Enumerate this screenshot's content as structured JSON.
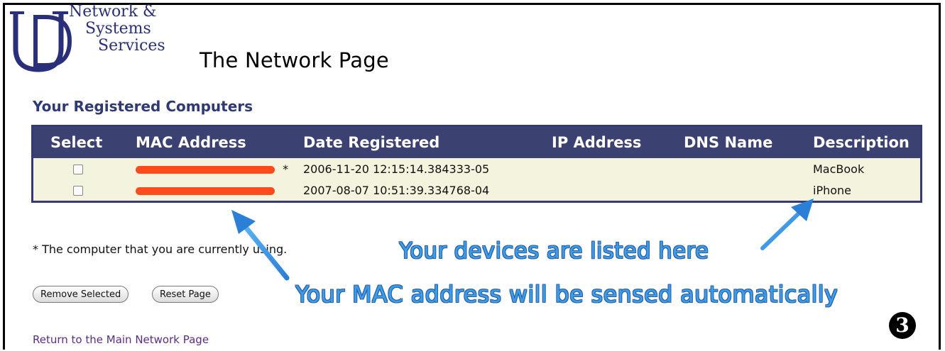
{
  "logo": {
    "line1": "Network &",
    "line2": "Systems",
    "line3": "Services",
    "color": "#2a2f7a"
  },
  "page_title": "The Network Page",
  "section_title": "Your Registered Computers",
  "table": {
    "headers": [
      "Select",
      "MAC Address",
      "Date Registered",
      "IP Address",
      "DNS Name",
      "Description"
    ],
    "rows": [
      {
        "mac_suffix": "*",
        "date": "2006-11-20 12:15:14.384333-05",
        "ip": "",
        "dns": "",
        "description": "MacBook"
      },
      {
        "mac_suffix": "",
        "date": "2007-08-07 10:51:39.334768-04",
        "ip": "",
        "dns": "",
        "description": "iPhone"
      }
    ],
    "header_color": "#3b4170",
    "row_color": "#f4f3dd"
  },
  "note": "* The computer that you are currently using.",
  "buttons": {
    "remove": "Remove Selected",
    "reset": "Reset Page"
  },
  "link": "Return to the Main Network Page",
  "callouts": {
    "devices": "Your devices are listed here",
    "mac": "Your MAC address will be sensed automatically",
    "color": "#3b9ee8"
  },
  "step_badge": "3"
}
